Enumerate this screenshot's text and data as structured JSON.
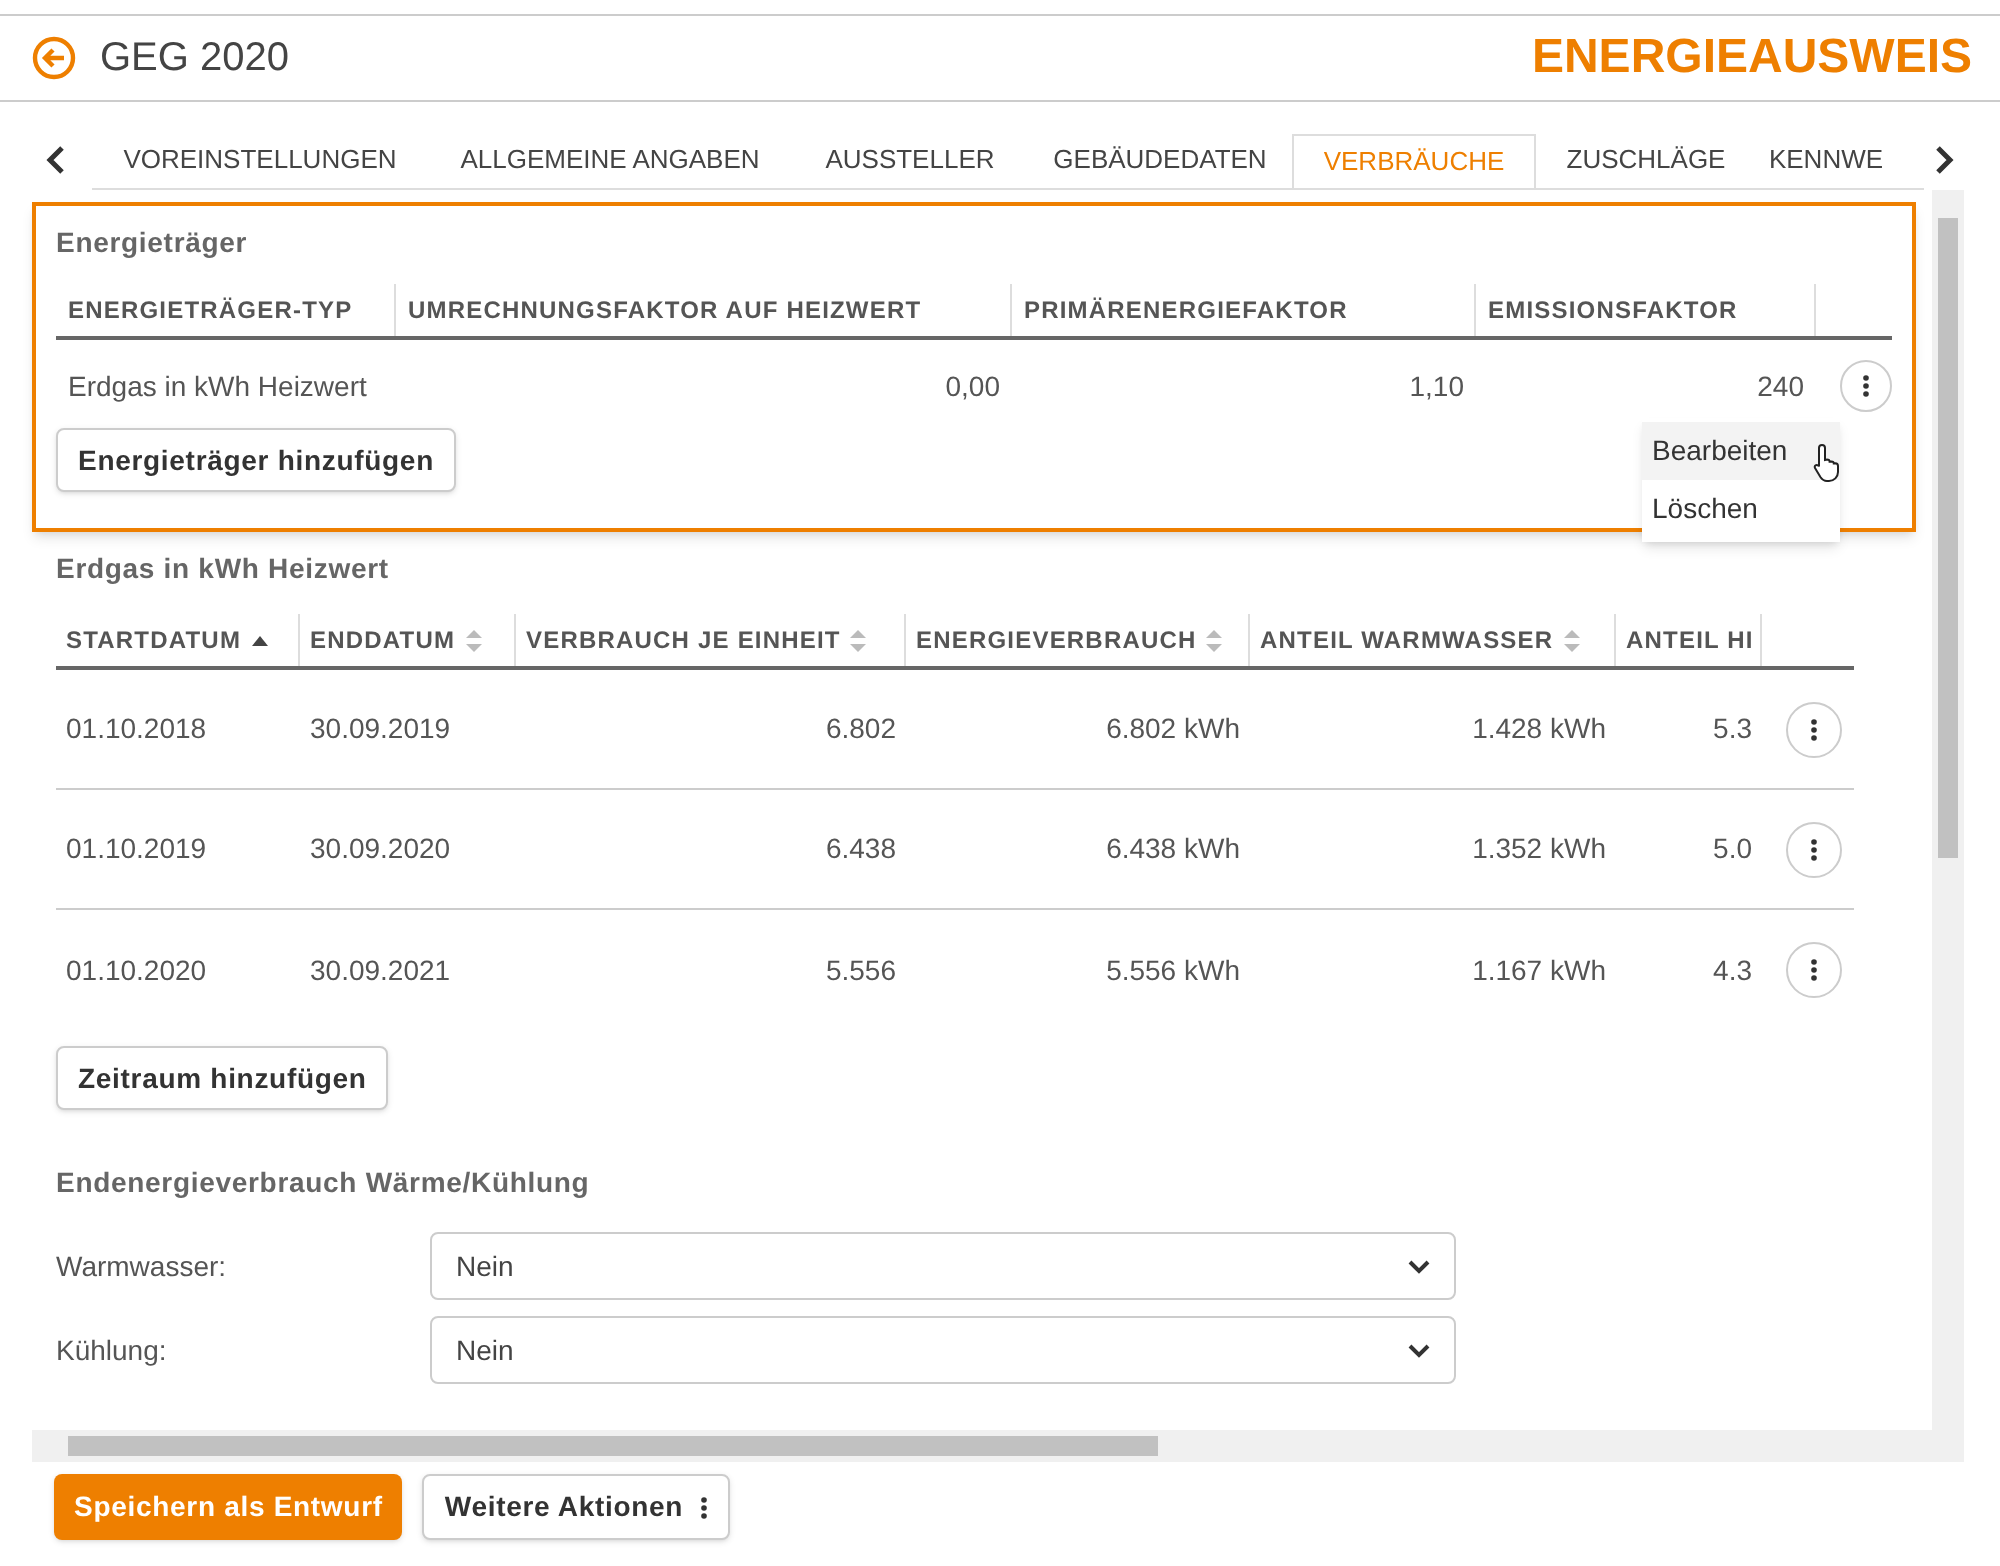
{
  "header": {
    "title": "GEG 2020",
    "brand": "ENERGIEAUSWEIS"
  },
  "tabs": [
    {
      "label": "VOREINSTELLUNGEN",
      "selected": false
    },
    {
      "label": "ALLGEMEINE ANGABEN",
      "selected": false
    },
    {
      "label": "AUSSTELLER",
      "selected": false
    },
    {
      "label": "GEBÄUDEDATEN",
      "selected": false
    },
    {
      "label": "VERBRÄUCHE",
      "selected": true
    },
    {
      "label": "ZUSCHLÄGE",
      "selected": false
    },
    {
      "label": "KENNWE",
      "selected": false
    }
  ],
  "carriers": {
    "title": "Energieträger",
    "columns": [
      "ENERGIETRÄGER-TYP",
      "UMRECHNUNGSFAKTOR AUF HEIZWERT",
      "PRIMÄRENERGIEFAKTOR",
      "EMISSIONSFAKTOR"
    ],
    "rows": [
      [
        "Erdgas in kWh Heizwert",
        "0,00",
        "1,10",
        "240"
      ]
    ],
    "add_button": "Energieträger hinzufügen",
    "menu": [
      "Bearbeiten",
      "Löschen"
    ]
  },
  "periods": {
    "title": "Erdgas in kWh Heizwert",
    "columns": [
      {
        "label": "STARTDATUM",
        "sorted": true
      },
      {
        "label": "ENDDATUM",
        "sorted": false
      },
      {
        "label": "VERBRAUCH JE EINHEIT",
        "sorted": false
      },
      {
        "label": "ENERGIEVERBRAUCH",
        "sorted": false
      },
      {
        "label": "ANTEIL WARMWASSER",
        "sorted": false
      },
      {
        "label": "ANTEIL HI"
      }
    ],
    "rows": [
      [
        "01.10.2018",
        "30.09.2019",
        "6.802",
        "6.802 kWh",
        "1.428 kWh",
        "5.3"
      ],
      [
        "01.10.2019",
        "30.09.2020",
        "6.438",
        "6.438 kWh",
        "1.352 kWh",
        "5.0"
      ],
      [
        "01.10.2020",
        "30.09.2021",
        "5.556",
        "5.556 kWh",
        "1.167 kWh",
        "4.3"
      ]
    ],
    "add_button": "Zeitraum hinzufügen"
  },
  "final_energy": {
    "title": "Endenergieverbrauch Wärme/Kühlung",
    "fields": [
      {
        "label": "Warmwasser:",
        "value": "Nein"
      },
      {
        "label": "Kühlung:",
        "value": "Nein"
      }
    ]
  },
  "footer": {
    "save_button": "Speichern als Entwurf",
    "more_button": "Weitere Aktionen"
  }
}
